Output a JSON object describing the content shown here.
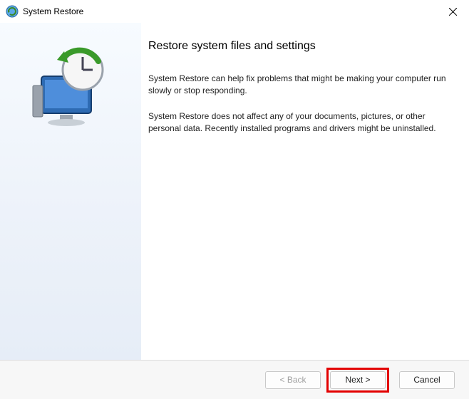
{
  "window": {
    "title": "System Restore"
  },
  "content": {
    "heading": "Restore system files and settings",
    "para1": "System Restore can help fix problems that might be making your computer run slowly or stop responding.",
    "para2": "System Restore does not affect any of your documents, pictures, or other personal data. Recently installed programs and drivers might be uninstalled."
  },
  "buttons": {
    "back": "< Back",
    "next": "Next >",
    "cancel": "Cancel"
  }
}
